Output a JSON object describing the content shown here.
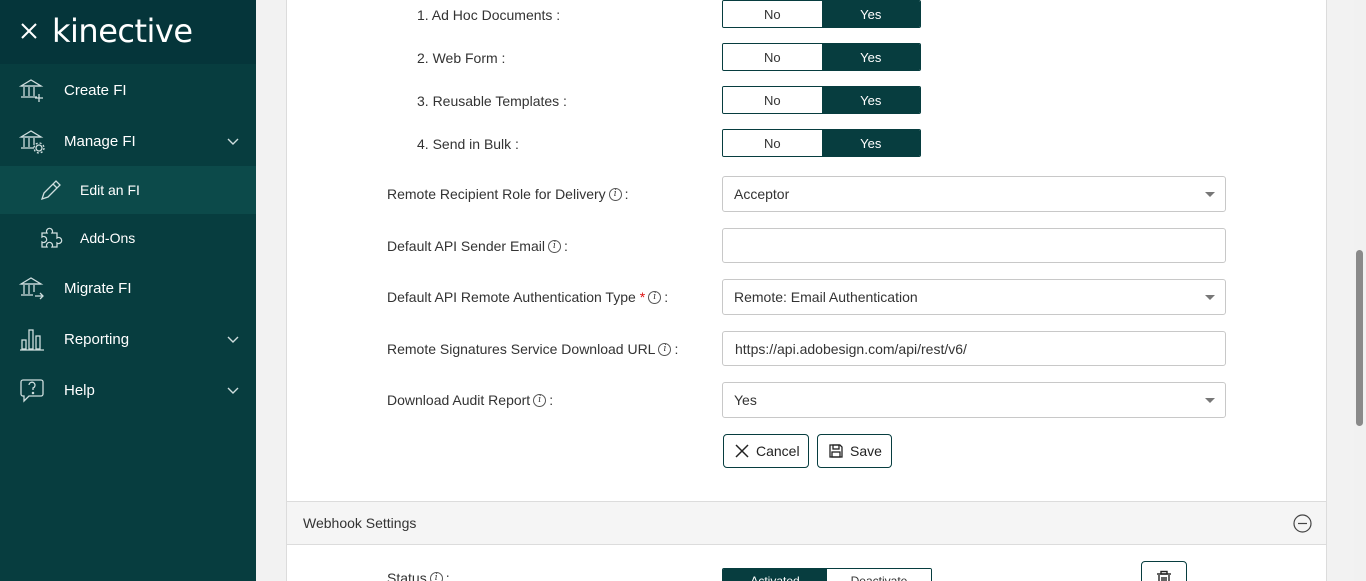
{
  "app": {
    "logo": "kinective"
  },
  "sidebar": {
    "items": [
      {
        "label": "Create FI",
        "icon": "bank-plus-icon"
      },
      {
        "label": "Manage FI",
        "icon": "bank-gear-icon"
      },
      {
        "label": "Edit an FI",
        "icon": "pencil-icon"
      },
      {
        "label": "Add-Ons",
        "icon": "puzzle-icon"
      },
      {
        "label": "Migrate FI",
        "icon": "bank-arrow-icon"
      },
      {
        "label": "Reporting",
        "icon": "bar-chart-icon"
      },
      {
        "label": "Help",
        "icon": "help-bubble-icon"
      }
    ]
  },
  "form": {
    "toggles": [
      {
        "label": "1. Ad Hoc Documents :",
        "no": "No",
        "yes": "Yes"
      },
      {
        "label": "2. Web Form :",
        "no": "No",
        "yes": "Yes"
      },
      {
        "label": "3. Reusable Templates :",
        "no": "No",
        "yes": "Yes"
      },
      {
        "label": "4. Send in Bulk :",
        "no": "No",
        "yes": "Yes"
      }
    ],
    "recipient_role": {
      "label": "Remote Recipient Role for Delivery",
      "value": "Acceptor"
    },
    "sender_email": {
      "label": "Default API Sender Email",
      "value": ""
    },
    "auth_type": {
      "label": "Default API Remote Authentication Type",
      "required": "*",
      "value": "Remote: Email Authentication"
    },
    "download_url": {
      "label": "Remote Signatures Service Download URL",
      "value": "https://api.adobesign.com/api/rest/v6/"
    },
    "audit_report": {
      "label": "Download Audit Report",
      "value": "Yes"
    },
    "colon": ":",
    "info": "i",
    "cancel_label": "Cancel",
    "save_label": "Save"
  },
  "webhook": {
    "title": "Webhook Settings",
    "status_label": "Status",
    "activated": "Activated",
    "deactivate": "Deactivate"
  },
  "colors": {
    "brand": "#073d3f",
    "sidebar": "#073d3f",
    "required": "#dd1111"
  }
}
